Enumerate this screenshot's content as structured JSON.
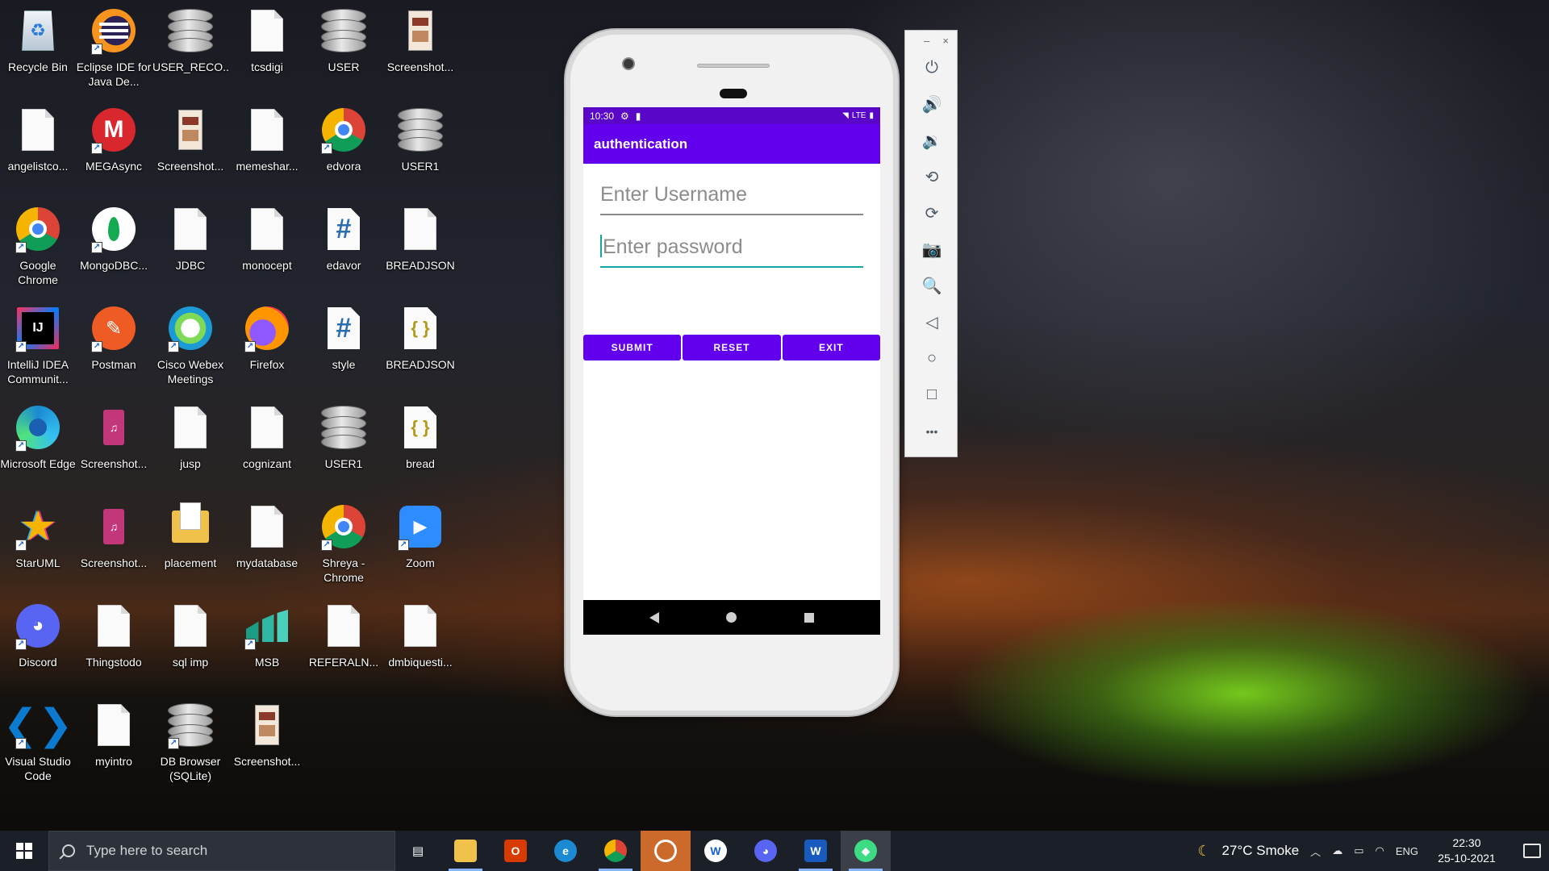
{
  "desktop": {
    "icons": [
      {
        "label": "Recycle Bin",
        "glyph": "recycle-bin-icon"
      },
      {
        "label": "Eclipse IDE for Java De...",
        "glyph": "eclipse-icon"
      },
      {
        "label": "USER_RECO...",
        "glyph": "database-icon"
      },
      {
        "label": "tcsdigi",
        "glyph": "file-icon"
      },
      {
        "label": "USER",
        "glyph": "database-icon"
      },
      {
        "label": "Screenshot...",
        "glyph": "image-thumb-icon"
      },
      {
        "label": "angelistco...",
        "glyph": "file-icon"
      },
      {
        "label": "MEGAsync",
        "glyph": "megasync-icon"
      },
      {
        "label": "Screenshot...",
        "glyph": "image-thumb-icon"
      },
      {
        "label": "memeshar...",
        "glyph": "file-icon"
      },
      {
        "label": "edvora",
        "glyph": "chrome-icon"
      },
      {
        "label": "USER1",
        "glyph": "database-icon"
      },
      {
        "label": "Google Chrome",
        "glyph": "chrome-icon"
      },
      {
        "label": "MongoDBC...",
        "glyph": "mongodb-icon"
      },
      {
        "label": "JDBC",
        "glyph": "file-icon"
      },
      {
        "label": "monocept",
        "glyph": "file-icon"
      },
      {
        "label": "edavor",
        "glyph": "csharp-file-icon"
      },
      {
        "label": "BREADJSON",
        "glyph": "file-icon"
      },
      {
        "label": "IntelliJ IDEA Communit...",
        "glyph": "intellij-icon"
      },
      {
        "label": "Postman",
        "glyph": "postman-icon"
      },
      {
        "label": "Cisco Webex Meetings",
        "glyph": "webex-icon"
      },
      {
        "label": "Firefox",
        "glyph": "firefox-icon"
      },
      {
        "label": "style",
        "glyph": "csharp-file-icon"
      },
      {
        "label": "BREADJSON",
        "glyph": "json-file-icon"
      },
      {
        "label": "Microsoft Edge",
        "glyph": "edge-icon"
      },
      {
        "label": "Screenshot...",
        "glyph": "media-file-icon"
      },
      {
        "label": "jusp",
        "glyph": "file-icon"
      },
      {
        "label": "cognizant",
        "glyph": "file-icon"
      },
      {
        "label": "USER1",
        "glyph": "database-icon"
      },
      {
        "label": "bread",
        "glyph": "json-file-icon"
      },
      {
        "label": "StarUML",
        "glyph": "staruml-icon"
      },
      {
        "label": "Screenshot...",
        "glyph": "media-file-icon"
      },
      {
        "label": "placement",
        "glyph": "folder-icon"
      },
      {
        "label": "mydatabase",
        "glyph": "file-icon"
      },
      {
        "label": "Shreya - Chrome",
        "glyph": "chrome-icon"
      },
      {
        "label": "Zoom",
        "glyph": "zoom-icon"
      },
      {
        "label": "Discord",
        "glyph": "discord-icon"
      },
      {
        "label": "Thingstodo",
        "glyph": "file-icon"
      },
      {
        "label": "sql imp",
        "glyph": "file-icon"
      },
      {
        "label": "MSB",
        "glyph": "msb-icon"
      },
      {
        "label": "REFERALN...",
        "glyph": "file-icon"
      },
      {
        "label": "dmbiquesti...",
        "glyph": "file-icon"
      },
      {
        "label": "Visual Studio Code",
        "glyph": "vscode-icon"
      },
      {
        "label": "myintro",
        "glyph": "file-icon"
      },
      {
        "label": "DB Browser (SQLite)",
        "glyph": "database-icon"
      },
      {
        "label": "Screenshot...",
        "glyph": "image-thumb-icon"
      }
    ]
  },
  "phone": {
    "status_time": "10:30",
    "status_network": "LTE",
    "app_title": "authentication",
    "username_placeholder": "Enter Username",
    "password_placeholder": "Enter password",
    "buttons": {
      "submit": "SUBMIT",
      "reset": "RESET",
      "exit": "EXIT"
    },
    "accent_color": "#6200ee",
    "statusbar_color": "#5a06c9"
  },
  "emulator_toolbar": {
    "minimize": "–",
    "close": "×",
    "controls": [
      "power-icon",
      "volume-up-icon",
      "volume-down-icon",
      "rotate-left-icon",
      "rotate-right-icon",
      "camera-icon",
      "zoom-icon",
      "back-icon",
      "home-icon",
      "overview-icon",
      "more-icon"
    ],
    "more": "•••"
  },
  "taskbar": {
    "search_placeholder": "Type here to search",
    "apps": [
      "task-view-icon",
      "file-explorer-icon",
      "office-icon",
      "edge-icon",
      "chrome-icon",
      "app-icon",
      "app-icon-2",
      "discord-icon",
      "word-icon",
      "android-studio-icon"
    ],
    "weather": "27°C  Smoke",
    "language": "ENG",
    "time": "22:30",
    "date": "25-10-2021"
  }
}
